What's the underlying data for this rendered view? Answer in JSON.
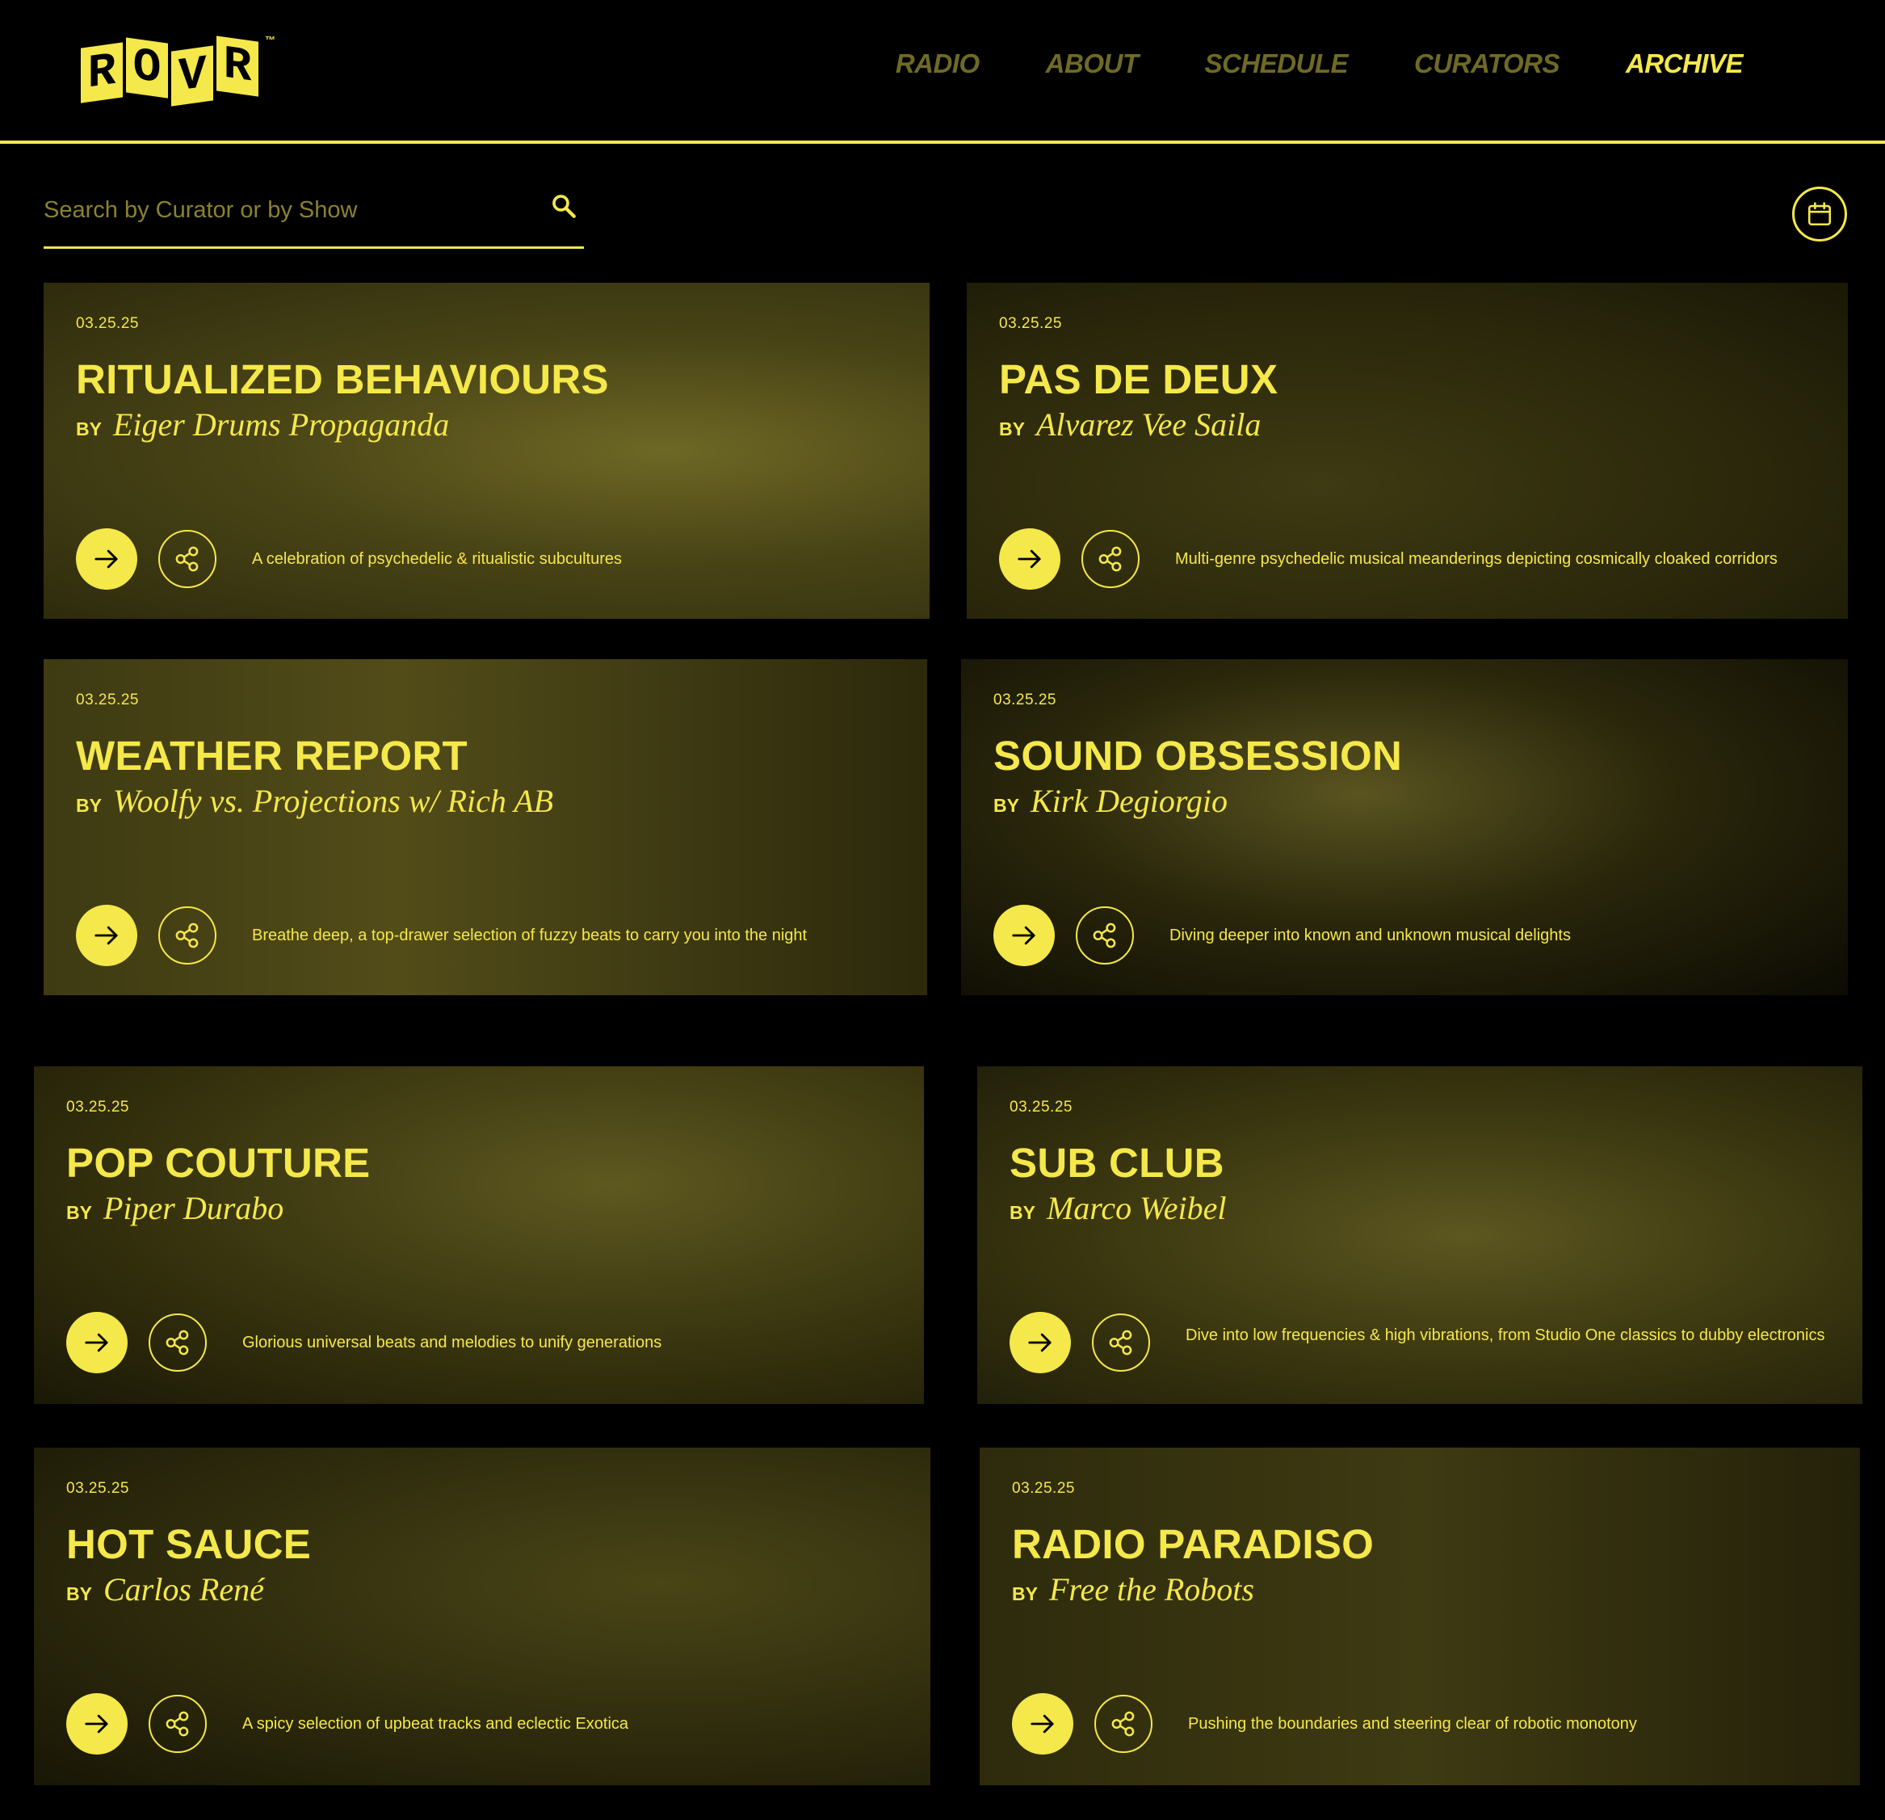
{
  "brand": {
    "logo_letters": [
      "R",
      "O",
      "V",
      "R"
    ],
    "trademark": "™",
    "accent_color": "#f5e84a",
    "background_color": "#000000",
    "inactive_nav_color": "#6f6a24"
  },
  "nav": {
    "items": [
      {
        "label": "RADIO",
        "active": false
      },
      {
        "label": "ABOUT",
        "active": false
      },
      {
        "label": "SCHEDULE",
        "active": false
      },
      {
        "label": "CURATORS",
        "active": false
      },
      {
        "label": "ARCHIVE",
        "active": true
      }
    ]
  },
  "search": {
    "placeholder": "Search by Curator or by Show",
    "value": "",
    "icon": "search-icon"
  },
  "calendar": {
    "icon": "calendar-icon"
  },
  "by_label": "BY",
  "shows": [
    {
      "date": "03.25.25",
      "title": "RITUALIZED BEHAVIOURS",
      "curator": "Eiger Drums Propaganda",
      "description": "A celebration of psychedelic & ritualistic subcultures"
    },
    {
      "date": "03.25.25",
      "title": "PAS DE DEUX",
      "curator": "Alvarez Vee Saila",
      "description": "Multi-genre psychedelic musical meanderings depicting cosmically cloaked corridors"
    },
    {
      "date": "03.25.25",
      "title": "WEATHER REPORT",
      "curator": "Woolfy vs. Projections w/ Rich AB",
      "description": "Breathe deep, a top-drawer selection of fuzzy beats to carry you into the night"
    },
    {
      "date": "03.25.25",
      "title": "SOUND OBSESSION",
      "curator": "Kirk Degiorgio",
      "description": "Diving deeper into known and unknown musical delights"
    },
    {
      "date": "03.25.25",
      "title": "POP COUTURE",
      "curator": "Piper Durabo",
      "description": "Glorious universal beats and melodies to unify generations"
    },
    {
      "date": "03.25.25",
      "title": "SUB CLUB",
      "curator": "Marco Weibel",
      "description": "Dive into low frequencies & high vibrations, from Studio One classics to dubby electronics"
    },
    {
      "date": "03.25.25",
      "title": "HOT SAUCE",
      "curator": "Carlos René",
      "description": "A spicy selection of upbeat tracks and eclectic Exotica"
    },
    {
      "date": "03.25.25",
      "title": "RADIO PARADISO",
      "curator": "Free the Robots",
      "description": "Pushing the boundaries and steering clear of robotic monotony"
    }
  ]
}
